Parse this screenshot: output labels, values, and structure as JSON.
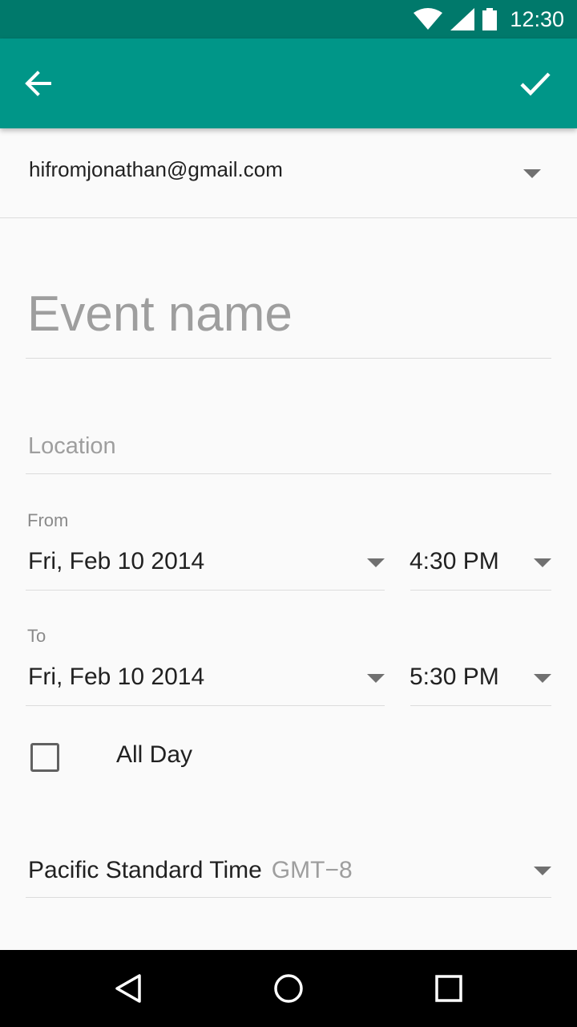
{
  "status_bar": {
    "time": "12:30",
    "icons": [
      "wifi-icon",
      "cell-signal-icon",
      "battery-icon"
    ]
  },
  "app_bar": {
    "back_icon": "arrow-back-icon",
    "confirm_icon": "check-icon",
    "color": "#009688"
  },
  "account": {
    "email": "hifromjonathan@gmail.com"
  },
  "form": {
    "event_name_placeholder": "Event name",
    "location_placeholder": "Location",
    "from": {
      "label": "From",
      "date": "Fri, Feb 10 2014",
      "time": "4:30 PM"
    },
    "to": {
      "label": "To",
      "date": "Fri, Feb 10 2014",
      "time": "5:30 PM"
    },
    "all_day": {
      "label": "All Day",
      "checked": false
    },
    "timezone": {
      "name": "Pacific Standard Time",
      "offset": "GMT−8"
    }
  },
  "nav_bar": {
    "icons": [
      "back-triangle-icon",
      "home-circle-icon",
      "recents-square-icon"
    ]
  }
}
